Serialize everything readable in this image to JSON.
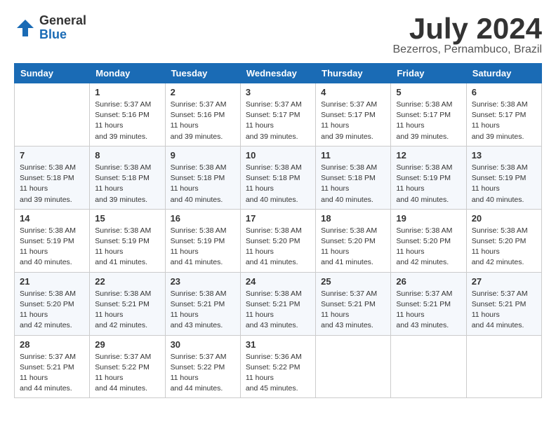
{
  "header": {
    "logo_general": "General",
    "logo_blue": "Blue",
    "title": "July 2024",
    "subtitle": "Bezerros, Pernambuco, Brazil"
  },
  "weekdays": [
    "Sunday",
    "Monday",
    "Tuesday",
    "Wednesday",
    "Thursday",
    "Friday",
    "Saturday"
  ],
  "weeks": [
    [
      {
        "day": "",
        "sunrise": "",
        "sunset": "",
        "daylight": ""
      },
      {
        "day": "1",
        "sunrise": "Sunrise: 5:37 AM",
        "sunset": "Sunset: 5:16 PM",
        "daylight": "Daylight: 11 hours and 39 minutes."
      },
      {
        "day": "2",
        "sunrise": "Sunrise: 5:37 AM",
        "sunset": "Sunset: 5:16 PM",
        "daylight": "Daylight: 11 hours and 39 minutes."
      },
      {
        "day": "3",
        "sunrise": "Sunrise: 5:37 AM",
        "sunset": "Sunset: 5:17 PM",
        "daylight": "Daylight: 11 hours and 39 minutes."
      },
      {
        "day": "4",
        "sunrise": "Sunrise: 5:37 AM",
        "sunset": "Sunset: 5:17 PM",
        "daylight": "Daylight: 11 hours and 39 minutes."
      },
      {
        "day": "5",
        "sunrise": "Sunrise: 5:38 AM",
        "sunset": "Sunset: 5:17 PM",
        "daylight": "Daylight: 11 hours and 39 minutes."
      },
      {
        "day": "6",
        "sunrise": "Sunrise: 5:38 AM",
        "sunset": "Sunset: 5:17 PM",
        "daylight": "Daylight: 11 hours and 39 minutes."
      }
    ],
    [
      {
        "day": "7",
        "sunrise": "Sunrise: 5:38 AM",
        "sunset": "Sunset: 5:18 PM",
        "daylight": "Daylight: 11 hours and 39 minutes."
      },
      {
        "day": "8",
        "sunrise": "Sunrise: 5:38 AM",
        "sunset": "Sunset: 5:18 PM",
        "daylight": "Daylight: 11 hours and 39 minutes."
      },
      {
        "day": "9",
        "sunrise": "Sunrise: 5:38 AM",
        "sunset": "Sunset: 5:18 PM",
        "daylight": "Daylight: 11 hours and 40 minutes."
      },
      {
        "day": "10",
        "sunrise": "Sunrise: 5:38 AM",
        "sunset": "Sunset: 5:18 PM",
        "daylight": "Daylight: 11 hours and 40 minutes."
      },
      {
        "day": "11",
        "sunrise": "Sunrise: 5:38 AM",
        "sunset": "Sunset: 5:18 PM",
        "daylight": "Daylight: 11 hours and 40 minutes."
      },
      {
        "day": "12",
        "sunrise": "Sunrise: 5:38 AM",
        "sunset": "Sunset: 5:19 PM",
        "daylight": "Daylight: 11 hours and 40 minutes."
      },
      {
        "day": "13",
        "sunrise": "Sunrise: 5:38 AM",
        "sunset": "Sunset: 5:19 PM",
        "daylight": "Daylight: 11 hours and 40 minutes."
      }
    ],
    [
      {
        "day": "14",
        "sunrise": "Sunrise: 5:38 AM",
        "sunset": "Sunset: 5:19 PM",
        "daylight": "Daylight: 11 hours and 40 minutes."
      },
      {
        "day": "15",
        "sunrise": "Sunrise: 5:38 AM",
        "sunset": "Sunset: 5:19 PM",
        "daylight": "Daylight: 11 hours and 41 minutes."
      },
      {
        "day": "16",
        "sunrise": "Sunrise: 5:38 AM",
        "sunset": "Sunset: 5:19 PM",
        "daylight": "Daylight: 11 hours and 41 minutes."
      },
      {
        "day": "17",
        "sunrise": "Sunrise: 5:38 AM",
        "sunset": "Sunset: 5:20 PM",
        "daylight": "Daylight: 11 hours and 41 minutes."
      },
      {
        "day": "18",
        "sunrise": "Sunrise: 5:38 AM",
        "sunset": "Sunset: 5:20 PM",
        "daylight": "Daylight: 11 hours and 41 minutes."
      },
      {
        "day": "19",
        "sunrise": "Sunrise: 5:38 AM",
        "sunset": "Sunset: 5:20 PM",
        "daylight": "Daylight: 11 hours and 42 minutes."
      },
      {
        "day": "20",
        "sunrise": "Sunrise: 5:38 AM",
        "sunset": "Sunset: 5:20 PM",
        "daylight": "Daylight: 11 hours and 42 minutes."
      }
    ],
    [
      {
        "day": "21",
        "sunrise": "Sunrise: 5:38 AM",
        "sunset": "Sunset: 5:20 PM",
        "daylight": "Daylight: 11 hours and 42 minutes."
      },
      {
        "day": "22",
        "sunrise": "Sunrise: 5:38 AM",
        "sunset": "Sunset: 5:21 PM",
        "daylight": "Daylight: 11 hours and 42 minutes."
      },
      {
        "day": "23",
        "sunrise": "Sunrise: 5:38 AM",
        "sunset": "Sunset: 5:21 PM",
        "daylight": "Daylight: 11 hours and 43 minutes."
      },
      {
        "day": "24",
        "sunrise": "Sunrise: 5:38 AM",
        "sunset": "Sunset: 5:21 PM",
        "daylight": "Daylight: 11 hours and 43 minutes."
      },
      {
        "day": "25",
        "sunrise": "Sunrise: 5:37 AM",
        "sunset": "Sunset: 5:21 PM",
        "daylight": "Daylight: 11 hours and 43 minutes."
      },
      {
        "day": "26",
        "sunrise": "Sunrise: 5:37 AM",
        "sunset": "Sunset: 5:21 PM",
        "daylight": "Daylight: 11 hours and 43 minutes."
      },
      {
        "day": "27",
        "sunrise": "Sunrise: 5:37 AM",
        "sunset": "Sunset: 5:21 PM",
        "daylight": "Daylight: 11 hours and 44 minutes."
      }
    ],
    [
      {
        "day": "28",
        "sunrise": "Sunrise: 5:37 AM",
        "sunset": "Sunset: 5:21 PM",
        "daylight": "Daylight: 11 hours and 44 minutes."
      },
      {
        "day": "29",
        "sunrise": "Sunrise: 5:37 AM",
        "sunset": "Sunset: 5:22 PM",
        "daylight": "Daylight: 11 hours and 44 minutes."
      },
      {
        "day": "30",
        "sunrise": "Sunrise: 5:37 AM",
        "sunset": "Sunset: 5:22 PM",
        "daylight": "Daylight: 11 hours and 44 minutes."
      },
      {
        "day": "31",
        "sunrise": "Sunrise: 5:36 AM",
        "sunset": "Sunset: 5:22 PM",
        "daylight": "Daylight: 11 hours and 45 minutes."
      },
      {
        "day": "",
        "sunrise": "",
        "sunset": "",
        "daylight": ""
      },
      {
        "day": "",
        "sunrise": "",
        "sunset": "",
        "daylight": ""
      },
      {
        "day": "",
        "sunrise": "",
        "sunset": "",
        "daylight": ""
      }
    ]
  ]
}
